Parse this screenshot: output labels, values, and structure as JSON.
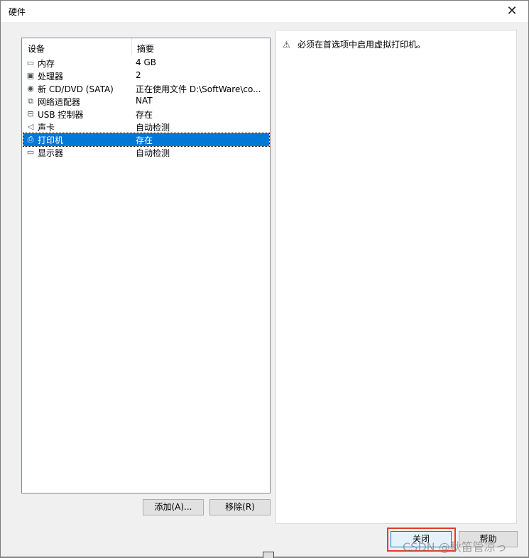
{
  "window": {
    "title": "硬件",
    "close_glyph": "✕"
  },
  "device_list": {
    "columns": [
      "设备",
      "摘要"
    ],
    "rows": [
      {
        "icon": "memory-icon",
        "glyph": "▭",
        "name": "内存",
        "summary": "4 GB"
      },
      {
        "icon": "processor-icon",
        "glyph": "▣",
        "name": "处理器",
        "summary": "2"
      },
      {
        "icon": "cd-dvd-icon",
        "glyph": "◉",
        "name": "新 CD/DVD (SATA)",
        "summary": "正在使用文件 D:\\SoftWare\\co..."
      },
      {
        "icon": "network-adapter-icon",
        "glyph": "⧉",
        "name": "网络适配器",
        "summary": "NAT"
      },
      {
        "icon": "usb-controller-icon",
        "glyph": "⊟",
        "name": "USB 控制器",
        "summary": "存在"
      },
      {
        "icon": "sound-card-icon",
        "glyph": "◁",
        "name": "声卡",
        "summary": "自动检测"
      },
      {
        "icon": "printer-icon",
        "glyph": "⎙",
        "name": "打印机",
        "summary": "存在",
        "selected": true
      },
      {
        "icon": "display-icon",
        "glyph": "▭",
        "name": "显示器",
        "summary": "自动检测"
      }
    ]
  },
  "right_panel": {
    "warning_icon": "⚠",
    "warning_text": "必须在首选项中启用虚拟打印机。"
  },
  "buttons": {
    "add": "添加(A)...",
    "remove": "移除(R)",
    "close": "关闭",
    "help": "帮助"
  },
  "watermark": "CSDN @秋笛管凉っ",
  "colors": {
    "selection": "#0078d7",
    "highlight_box": "#e33b2e"
  }
}
